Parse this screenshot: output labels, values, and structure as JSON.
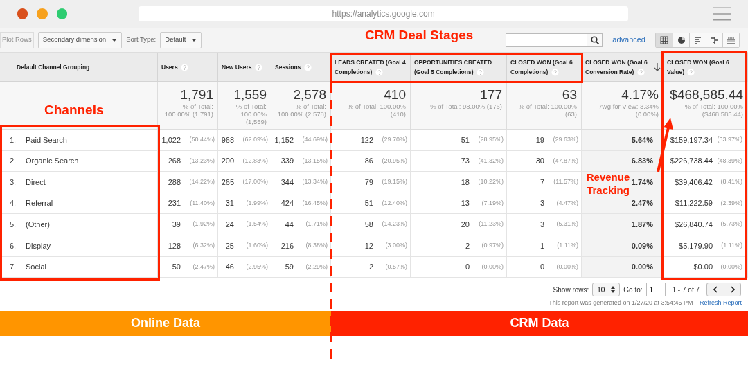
{
  "browser": {
    "url": "https://analytics.google.com"
  },
  "toolbar": {
    "plot_rows": {
      "label": "Plot Rows",
      "disabled": true
    },
    "secondary_dimension": "Secondary dimension",
    "sort_type_label": "Sort Type:",
    "sort_type": "Default",
    "advanced_link": "advanced",
    "view_buttons": [
      {
        "kind": "grid",
        "selected": true
      },
      {
        "kind": "pie",
        "selected": false
      },
      {
        "kind": "bars",
        "selected": false
      },
      {
        "kind": "compare",
        "selected": false
      },
      {
        "kind": "pivot",
        "selected": false
      }
    ]
  },
  "table": {
    "columns": [
      {
        "label": "Default Channel Grouping",
        "help": false,
        "sorted": false
      },
      {
        "label": "Users",
        "help": true,
        "sorted": false
      },
      {
        "label": "New Users",
        "help": true,
        "sorted": false
      },
      {
        "label": "Sessions",
        "help": true,
        "sorted": false
      },
      {
        "label": "LEADS CREATED (Goal 4 Completions)",
        "help": true,
        "sorted": false
      },
      {
        "label": "OPPORTUNITIES CREATED (Goal 5 Completions)",
        "help": true,
        "sorted": false
      },
      {
        "label": "CLOSED WON (Goal 6 Completions)",
        "help": true,
        "sorted": false
      },
      {
        "label": "CLOSED WON (Goal 6 Conversion Rate)",
        "help": true,
        "sorted": true
      },
      {
        "label": "CLOSED WON (Goal 6 Value)",
        "help": true,
        "sorted": false
      }
    ],
    "totals": [
      {
        "value": "1,791",
        "note": "% of Total: 100.00% (1,791)"
      },
      {
        "value": "1,559",
        "note": "% of Total: 100.00% (1,559)"
      },
      {
        "value": "2,578",
        "note": "% of Total: 100.00% (2,578)"
      },
      {
        "value": "410",
        "note": "% of Total: 100.00% (410)"
      },
      {
        "value": "177",
        "note": "% of Total: 98.00% (176)"
      },
      {
        "value": "63",
        "note": "% of Total: 100.00% (63)"
      },
      {
        "value": "4.17%",
        "note": "Avg for View: 3.34% (0.00%)"
      },
      {
        "value": "$468,585.44",
        "note": "% of Total: 100.00% ($468,585.44)"
      }
    ],
    "rows": [
      {
        "cells": [
          {
            "index": "1.",
            "name": "Paid Search"
          },
          {
            "value": "1,022",
            "share": "(50.44%)"
          },
          {
            "value": "968",
            "share": "(62.09%)"
          },
          {
            "value": "1,152",
            "share": "(44.69%)"
          },
          {
            "value": "122",
            "share": "(29.70%)"
          },
          {
            "value": "51",
            "share": "(28.95%)"
          },
          {
            "value": "19",
            "share": "(29.63%)"
          },
          {
            "value": "5.64%"
          },
          {
            "value": "$159,197.34",
            "share": "(33.97%)"
          }
        ]
      },
      {
        "cells": [
          {
            "index": "2.",
            "name": "Organic Search"
          },
          {
            "value": "268",
            "share": "(13.23%)"
          },
          {
            "value": "200",
            "share": "(12.83%)"
          },
          {
            "value": "339",
            "share": "(13.15%)"
          },
          {
            "value": "86",
            "share": "(20.95%)"
          },
          {
            "value": "73",
            "share": "(41.32%)"
          },
          {
            "value": "30",
            "share": "(47.87%)"
          },
          {
            "value": "6.83%"
          },
          {
            "value": "$226,738.44",
            "share": "(48.39%)"
          }
        ]
      },
      {
        "cells": [
          {
            "index": "3.",
            "name": "Direct"
          },
          {
            "value": "288",
            "share": "(14.22%)"
          },
          {
            "value": "265",
            "share": "(17.00%)"
          },
          {
            "value": "344",
            "share": "(13.34%)"
          },
          {
            "value": "79",
            "share": "(19.15%)"
          },
          {
            "value": "18",
            "share": "(10.22%)"
          },
          {
            "value": "7",
            "share": "(11.57%)"
          },
          {
            "value": "1.74%"
          },
          {
            "value": "$39,406.42",
            "share": "(8.41%)"
          }
        ]
      },
      {
        "cells": [
          {
            "index": "4.",
            "name": "Referral"
          },
          {
            "value": "231",
            "share": "(11.40%)"
          },
          {
            "value": "31",
            "share": "(1.99%)"
          },
          {
            "value": "424",
            "share": "(16.45%)"
          },
          {
            "value": "51",
            "share": "(12.40%)"
          },
          {
            "value": "13",
            "share": "(7.19%)"
          },
          {
            "value": "3",
            "share": "(4.47%)"
          },
          {
            "value": "2.47%"
          },
          {
            "value": "$11,222.59",
            "share": "(2.39%)"
          }
        ]
      },
      {
        "cells": [
          {
            "index": "5.",
            "name": "(Other)"
          },
          {
            "value": "39",
            "share": "(1.92%)"
          },
          {
            "value": "24",
            "share": "(1.54%)"
          },
          {
            "value": "44",
            "share": "(1.71%)"
          },
          {
            "value": "58",
            "share": "(14.23%)"
          },
          {
            "value": "20",
            "share": "(11.23%)"
          },
          {
            "value": "3",
            "share": "(5.31%)"
          },
          {
            "value": "1.87%"
          },
          {
            "value": "$26,840.74",
            "share": "(5.73%)"
          }
        ]
      },
      {
        "cells": [
          {
            "index": "6.",
            "name": "Display"
          },
          {
            "value": "128",
            "share": "(6.32%)"
          },
          {
            "value": "25",
            "share": "(1.60%)"
          },
          {
            "value": "216",
            "share": "(8.38%)"
          },
          {
            "value": "12",
            "share": "(3.00%)"
          },
          {
            "value": "2",
            "share": "(0.97%)"
          },
          {
            "value": "1",
            "share": "(1.11%)"
          },
          {
            "value": "0.09%"
          },
          {
            "value": "$5,179.90",
            "share": "(1.11%)"
          }
        ]
      },
      {
        "cells": [
          {
            "index": "7.",
            "name": "Social"
          },
          {
            "value": "50",
            "share": "(2.47%)"
          },
          {
            "value": "46",
            "share": "(2.95%)"
          },
          {
            "value": "59",
            "share": "(2.29%)"
          },
          {
            "value": "2",
            "share": "(0.57%)"
          },
          {
            "value": "0",
            "share": "(0.00%)"
          },
          {
            "value": "0",
            "share": "(0.00%)"
          },
          {
            "value": "0.00%"
          },
          {
            "value": "$0.00",
            "share": "(0.00%)"
          }
        ]
      }
    ]
  },
  "footer": {
    "show_rows_label": "Show rows:",
    "show_rows": "10",
    "goto_label": "Go to:",
    "goto": "1",
    "range": "1 - 7 of 7",
    "report_note": "This report was generated on 1/27/20 at 3:54:45 PM -",
    "refresh_link": "Refresh Report"
  },
  "annotations": {
    "deal_stages": "CRM Deal Stages",
    "channels": "Channels",
    "revenue": "Revenue Tracking",
    "online_band": "Online Data",
    "crm_band": "CRM Data"
  }
}
